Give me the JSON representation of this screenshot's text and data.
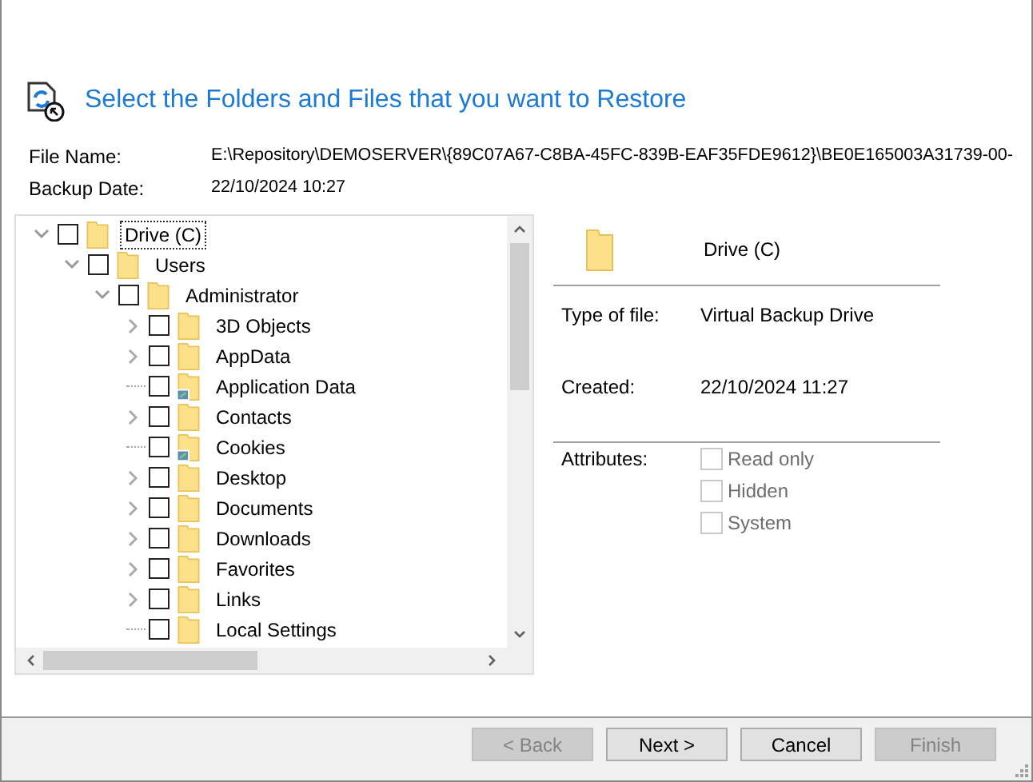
{
  "header": {
    "title": "Select the Folders and Files that you want to Restore"
  },
  "info": [
    {
      "label": "File Name:",
      "value": "E:\\Repository\\DEMOSERVER\\{89C07A67-C8BA-45FC-839B-EAF35FDE9612}\\BE0E165003A31739-00-"
    },
    {
      "label": "Backup Date:",
      "value": "22/10/2024 10:27"
    }
  ],
  "tree": [
    {
      "label": "Drive (C)",
      "expanded": true,
      "checked": false,
      "shortcut": false,
      "focused": true,
      "children": [
        {
          "label": "Users",
          "expanded": true,
          "checked": false,
          "shortcut": false,
          "focused": false,
          "children": [
            {
              "label": "Administrator",
              "expanded": true,
              "checked": false,
              "shortcut": false,
              "focused": false,
              "children": [
                {
                  "label": "3D Objects",
                  "expanded": false,
                  "checked": false,
                  "shortcut": false,
                  "focused": false
                },
                {
                  "label": "AppData",
                  "expanded": false,
                  "checked": false,
                  "shortcut": false,
                  "focused": false
                },
                {
                  "label": "Application Data",
                  "checked": false,
                  "shortcut": true,
                  "focused": false
                },
                {
                  "label": "Contacts",
                  "expanded": false,
                  "checked": false,
                  "shortcut": false,
                  "focused": false
                },
                {
                  "label": "Cookies",
                  "checked": false,
                  "shortcut": true,
                  "focused": false
                },
                {
                  "label": "Desktop",
                  "expanded": false,
                  "checked": false,
                  "shortcut": false,
                  "focused": false
                },
                {
                  "label": "Documents",
                  "expanded": false,
                  "checked": false,
                  "shortcut": false,
                  "focused": false
                },
                {
                  "label": "Downloads",
                  "expanded": false,
                  "checked": false,
                  "shortcut": false,
                  "focused": false
                },
                {
                  "label": "Favorites",
                  "expanded": false,
                  "checked": false,
                  "shortcut": false,
                  "focused": false
                },
                {
                  "label": "Links",
                  "expanded": false,
                  "checked": false,
                  "shortcut": false,
                  "focused": false
                },
                {
                  "label": "Local Settings",
                  "checked": false,
                  "shortcut": false,
                  "focused": false
                }
              ]
            }
          ]
        }
      ]
    }
  ],
  "details": {
    "name": "Drive (C)",
    "fields": [
      {
        "label": "Type of file:",
        "value": "Virtual Backup Drive"
      },
      {
        "label": "Created:",
        "value": "22/10/2024 11:27"
      }
    ],
    "attributes_label": "Attributes:",
    "attributes": [
      {
        "label": "Read only",
        "checked": false,
        "disabled": true
      },
      {
        "label": "Hidden",
        "checked": false,
        "disabled": true
      },
      {
        "label": "System",
        "checked": false,
        "disabled": true
      }
    ]
  },
  "buttons": [
    {
      "label": "< Back",
      "disabled": true
    },
    {
      "label": "Next >",
      "disabled": false
    },
    {
      "label": "Cancel",
      "disabled": false
    },
    {
      "label": "Finish",
      "disabled": true
    }
  ]
}
